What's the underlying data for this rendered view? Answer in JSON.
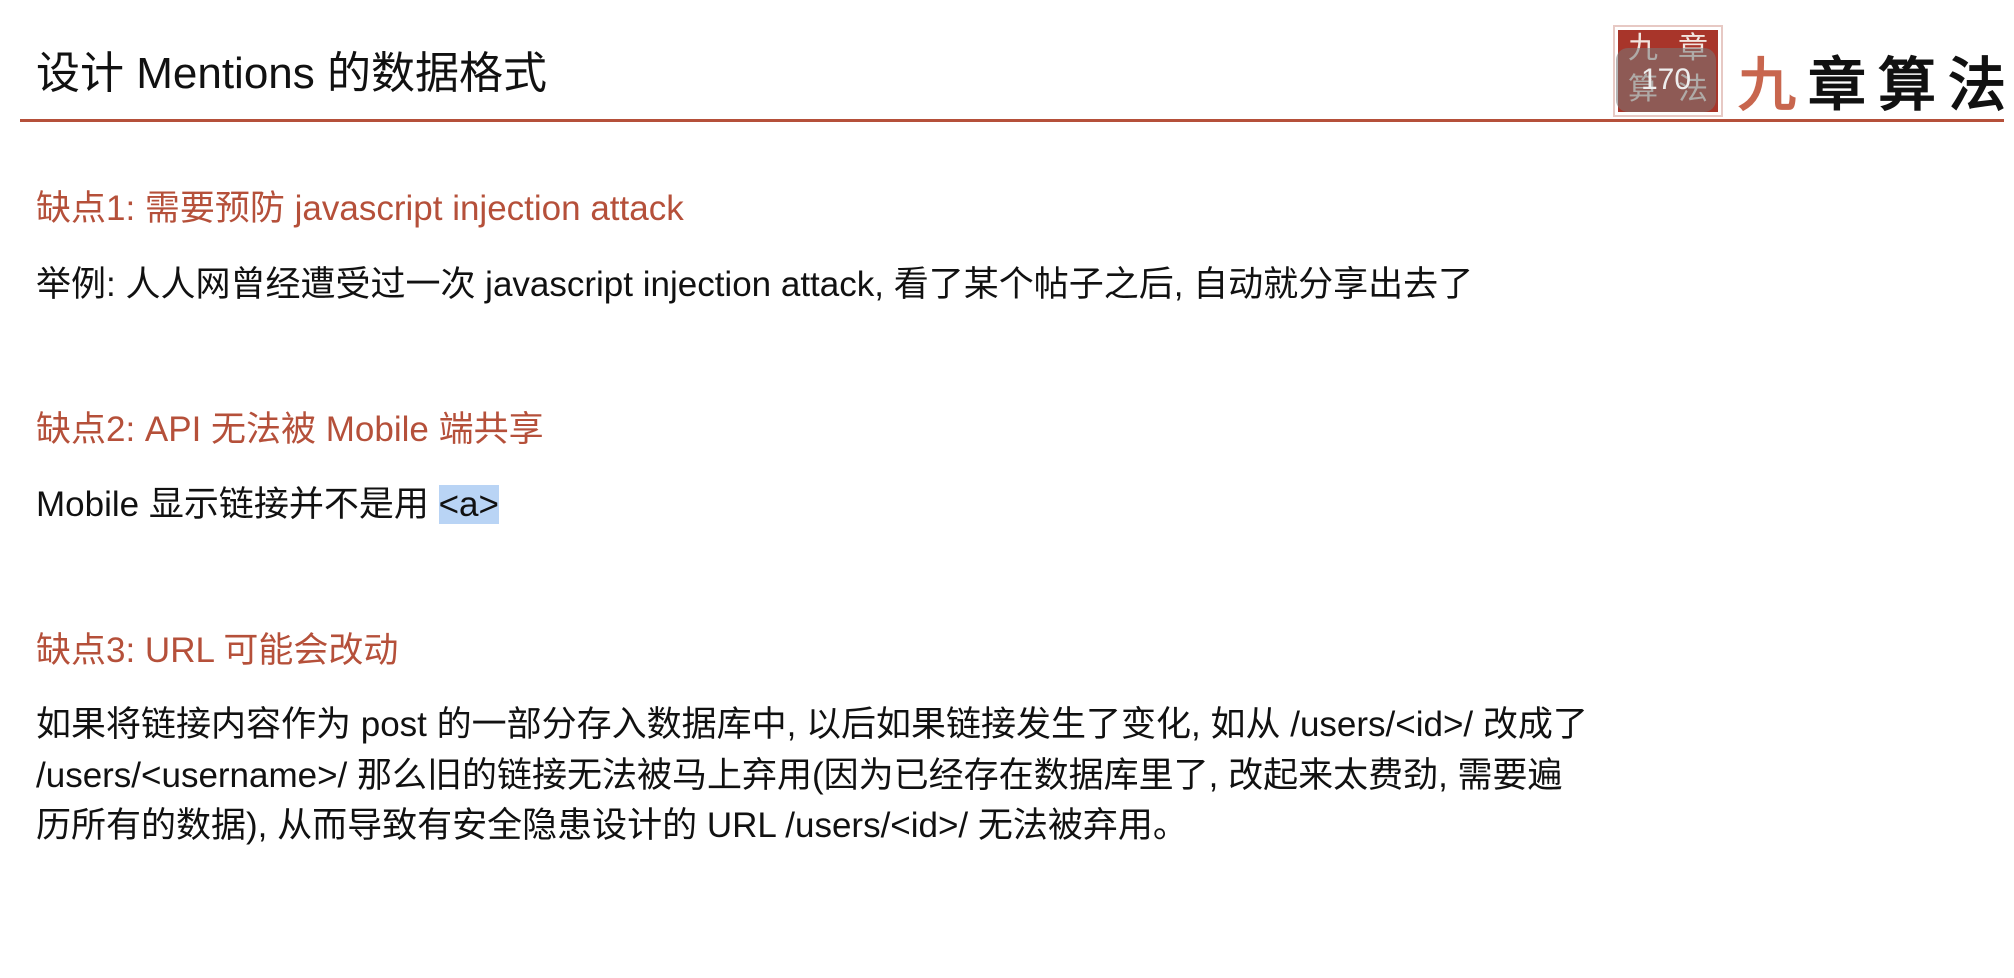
{
  "header": {
    "title": "设计 Mentions 的数据格式"
  },
  "logo": {
    "seal_text": "九章算法",
    "brand_first": "九",
    "brand_rest": "章算法",
    "page_badge": "170"
  },
  "colors": {
    "accent": "#b5503a",
    "selection": "#b9d4f5"
  },
  "sections": [
    {
      "heading": "缺点1: 需要预防 javascript injection attack",
      "lines": [
        "举例: 人人网曾经遭受过一次 javascript injection attack, 看了某个帖子之后, 自动就分享出去了"
      ]
    },
    {
      "heading": "缺点2: API 无法被 Mobile 端共享",
      "line_prefix": "Mobile 显示链接并不是用 ",
      "line_selected": "<a>"
    },
    {
      "heading": "缺点3: URL 可能会改动",
      "lines": [
        "如果将链接内容作为 post 的一部分存入数据库中, 以后如果链接发生了变化, 如从 /users/<id>/ 改成了",
        "/users/<username>/ 那么旧的链接无法被马上弃用(因为已经存在数据库里了, 改起来太费劲, 需要遍",
        "历所有的数据), 从而导致有安全隐患设计的 URL /users/<id>/ 无法被弃用。"
      ]
    }
  ]
}
